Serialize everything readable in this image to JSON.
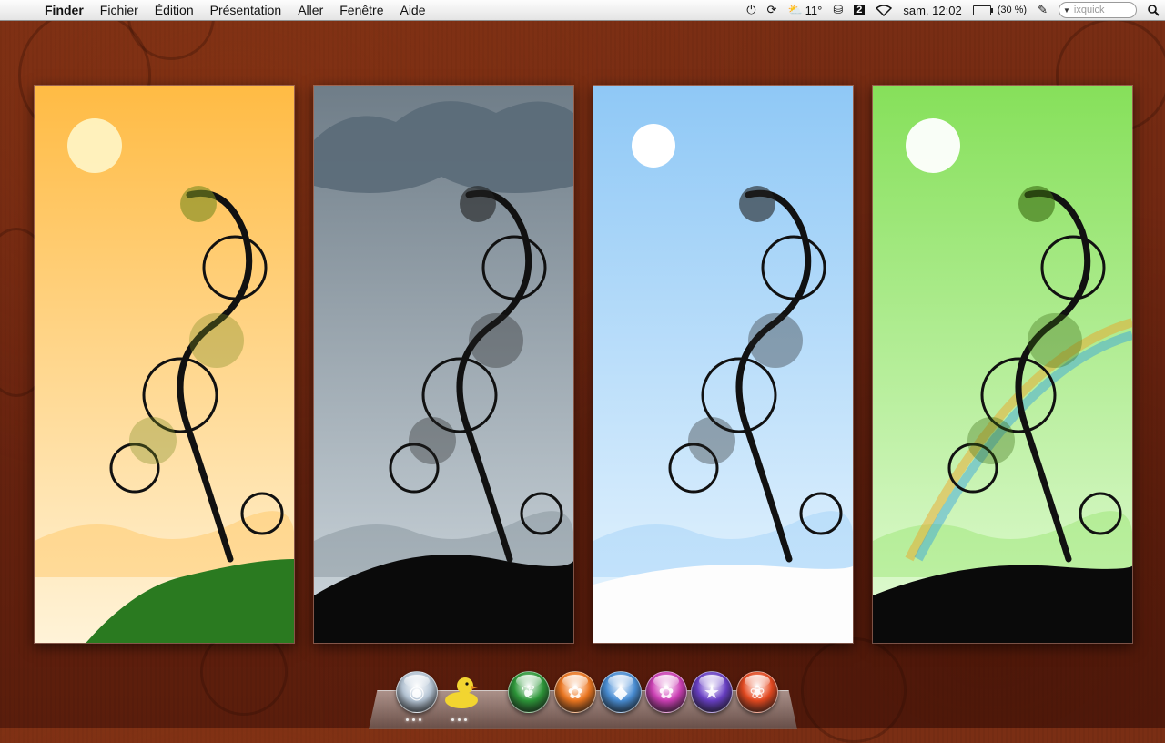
{
  "menubar": {
    "app_name": "Finder",
    "menus": [
      "Fichier",
      "Édition",
      "Présentation",
      "Aller",
      "Fenêtre",
      "Aide"
    ],
    "weather_temp": "11°",
    "spaces_number": "2",
    "clock": "sam. 12:02",
    "battery_percent": "(30 %)",
    "battery_level": 0.3,
    "search_placeholder": "ixquick"
  },
  "panels": [
    {
      "season": "autumn",
      "sky_top": "#ffbb44",
      "sky_bottom": "#fff3d8"
    },
    {
      "season": "rain",
      "sky_top": "#6f7d88",
      "sky_bottom": "#cfd8de"
    },
    {
      "season": "winter",
      "sky_top": "#8fc8f6",
      "sky_bottom": "#e8f5fe"
    },
    {
      "season": "spring",
      "sky_top": "#86e05a",
      "sky_bottom": "#e3fbd6"
    }
  ],
  "dock": {
    "items": [
      {
        "name": "finder-orb-icon",
        "color": "#b8c8d8",
        "glyph": "◉",
        "running": true
      },
      {
        "name": "cyberduck-icon",
        "color": "#f2d530",
        "glyph": "",
        "running": true
      },
      {
        "name": "green-leaf-orb-icon",
        "color": "#2e9a3a",
        "glyph": "❦",
        "running": false
      },
      {
        "name": "orange-flower-orb-icon",
        "color": "#f07820",
        "glyph": "✿",
        "running": false
      },
      {
        "name": "blue-crystal-orb-icon",
        "color": "#4a90d8",
        "glyph": "◆",
        "running": false
      },
      {
        "name": "pink-flower-orb-icon",
        "color": "#d040b8",
        "glyph": "✿",
        "running": false
      },
      {
        "name": "purple-star-orb-icon",
        "color": "#6a40c8",
        "glyph": "★",
        "running": false
      },
      {
        "name": "red-flower-orb-icon",
        "color": "#e84a20",
        "glyph": "❀",
        "running": false
      }
    ]
  }
}
